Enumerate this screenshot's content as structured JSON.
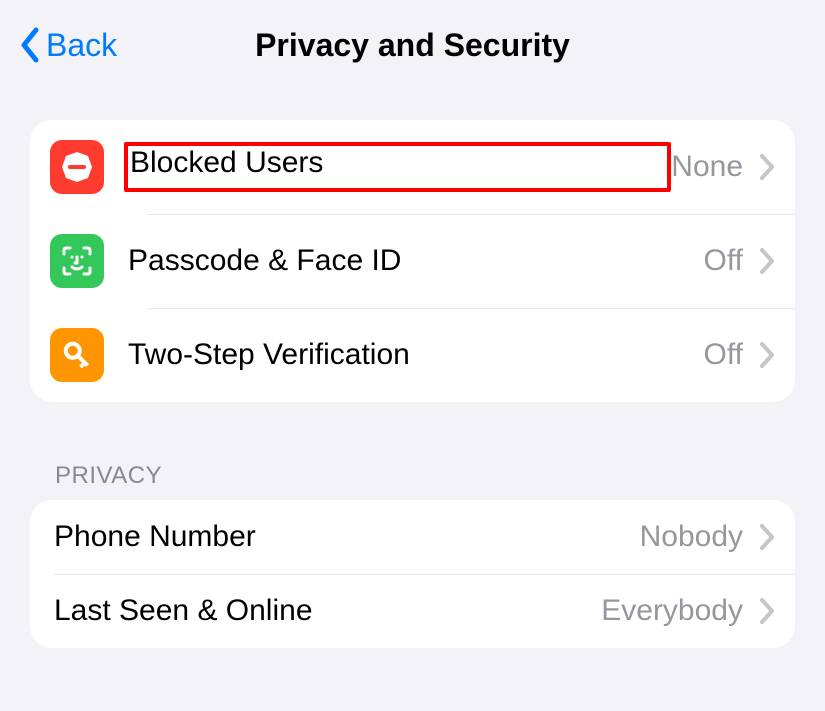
{
  "nav": {
    "back": "Back",
    "title": "Privacy and Security"
  },
  "group1": {
    "items": [
      {
        "label": "Blocked Users",
        "value": "None"
      },
      {
        "label": "Passcode & Face ID",
        "value": "Off"
      },
      {
        "label": "Two-Step Verification",
        "value": "Off"
      }
    ]
  },
  "section_header": "PRIVACY",
  "group2": {
    "items": [
      {
        "label": "Phone Number",
        "value": "Nobody"
      },
      {
        "label": "Last Seen & Online",
        "value": "Everybody"
      }
    ]
  },
  "colors": {
    "blocked_icon_bg": "#ff3b30",
    "passcode_icon_bg": "#34c759",
    "twostep_icon_bg": "#ff9500",
    "accent": "#007aff"
  }
}
